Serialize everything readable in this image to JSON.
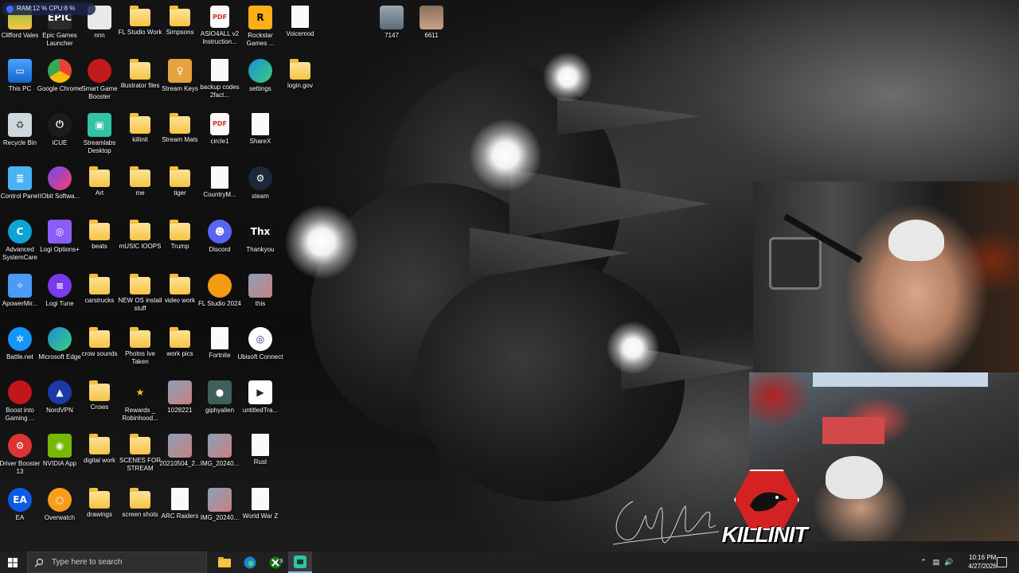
{
  "perf_overlay": {
    "text": "RAM:12 %  CPU:8 %"
  },
  "desktop": {
    "col1": [
      {
        "label": "Clifford Vales",
        "icon": "user-folder-icon"
      },
      {
        "label": "This PC",
        "icon": "pc-icon"
      },
      {
        "label": "Recycle Bin",
        "icon": "recycle-bin-icon"
      },
      {
        "label": "Control Panel",
        "icon": "control-panel-icon"
      },
      {
        "label": "Advanced SystemCare",
        "icon": "advanced-systemcare-icon"
      },
      {
        "label": "ApowerMir...",
        "icon": "apowermirror-icon"
      },
      {
        "label": "Battle.net",
        "icon": "battlenet-icon"
      },
      {
        "label": "Boost into Gaming ...",
        "icon": "boost-icon"
      },
      {
        "label": "Driver Booster 13",
        "icon": "driver-booster-icon"
      },
      {
        "label": "EA",
        "icon": "ea-icon"
      }
    ],
    "col2": [
      {
        "label": "Epic Games Launcher",
        "icon": "epic-games-icon"
      },
      {
        "label": "Google Chrome",
        "icon": "chrome-icon"
      },
      {
        "label": "iCUE",
        "icon": "icue-icon"
      },
      {
        "label": "IObit Softwa...",
        "icon": "iobit-icon"
      },
      {
        "label": "Logi Options+",
        "icon": "logi-options-icon"
      },
      {
        "label": "Logi Tune",
        "icon": "logi-tune-icon"
      },
      {
        "label": "Microsoft Edge",
        "icon": "edge-icon"
      },
      {
        "label": "NordVPN",
        "icon": "nordvpn-icon"
      },
      {
        "label": "NVIDIA App",
        "icon": "nvidia-icon"
      },
      {
        "label": "Overwatch",
        "icon": "overwatch-icon"
      }
    ],
    "col3": [
      {
        "label": "nnn",
        "icon": "app-icon"
      },
      {
        "label": "Smart Game Booster",
        "icon": "smart-game-booster-icon"
      },
      {
        "label": "Streamlabs Desktop",
        "icon": "streamlabs-icon"
      },
      {
        "label": "Art",
        "icon": "folder-icon"
      },
      {
        "label": "beats",
        "icon": "folder-icon"
      },
      {
        "label": "carstrucks",
        "icon": "folder-icon"
      },
      {
        "label": "crow sounds",
        "icon": "folder-icon"
      },
      {
        "label": "Crows",
        "icon": "folder-icon"
      },
      {
        "label": "digital work",
        "icon": "folder-icon"
      },
      {
        "label": "drawings",
        "icon": "folder-icon"
      }
    ],
    "col4": [
      {
        "label": "FL Studio Work",
        "icon": "folder-icon"
      },
      {
        "label": "illustrator files",
        "icon": "folder-icon"
      },
      {
        "label": "killinit",
        "icon": "folder-icon"
      },
      {
        "label": "me",
        "icon": "folder-icon"
      },
      {
        "label": "mUSIC lOOPS",
        "icon": "folder-icon"
      },
      {
        "label": "NEW OS install stuff",
        "icon": "folder-icon"
      },
      {
        "label": "Photos Ive Taken",
        "icon": "folder-icon"
      },
      {
        "label": "Rewards _ Robinhood...",
        "icon": "star-icon"
      },
      {
        "label": "SCENES FOR STREAM",
        "icon": "folder-icon"
      },
      {
        "label": "screen shots",
        "icon": "folder-icon"
      }
    ],
    "col5": [
      {
        "label": "Simpsons",
        "icon": "folder-icon"
      },
      {
        "label": "Stream Keys",
        "icon": "keys-icon"
      },
      {
        "label": "Stream Mats",
        "icon": "folder-icon"
      },
      {
        "label": "tiger",
        "icon": "folder-icon"
      },
      {
        "label": "Trump",
        "icon": "folder-icon"
      },
      {
        "label": "video work",
        "icon": "folder-icon"
      },
      {
        "label": "work pics",
        "icon": "folder-icon"
      },
      {
        "label": "1028221",
        "icon": "image-icon"
      },
      {
        "label": "20210504_2...",
        "icon": "image-icon"
      },
      {
        "label": "ARC Raiders",
        "icon": "file-icon"
      }
    ],
    "col6": [
      {
        "label": "ASIO4ALL v2 Instruction...",
        "icon": "pdf-icon"
      },
      {
        "label": "backup codes 2fact...",
        "icon": "file-icon"
      },
      {
        "label": "circle1",
        "icon": "pdf-icon"
      },
      {
        "label": "CountryM...",
        "icon": "file-icon"
      },
      {
        "label": "Discord",
        "icon": "discord-icon"
      },
      {
        "label": "FL Studio 2024",
        "icon": "fl-studio-icon"
      },
      {
        "label": "Fortnite",
        "icon": "file-icon"
      },
      {
        "label": "giphyalien",
        "icon": "alien-icon"
      },
      {
        "label": "IMG_20240...",
        "icon": "image-icon"
      },
      {
        "label": "IMG_20240...",
        "icon": "image-icon"
      }
    ],
    "col7": [
      {
        "label": "Rockstar Games ...",
        "icon": "rockstar-icon"
      },
      {
        "label": "settings",
        "icon": "edge-icon"
      },
      {
        "label": "ShareX",
        "icon": "file-icon"
      },
      {
        "label": "steam",
        "icon": "steam-icon"
      },
      {
        "label": "Thankyou",
        "icon": "thankyou-image-icon"
      },
      {
        "label": "this",
        "icon": "image-icon"
      },
      {
        "label": "Ubisoft Connect",
        "icon": "ubisoft-icon"
      },
      {
        "label": "untitledTra...",
        "icon": "video-icon"
      },
      {
        "label": "Rust",
        "icon": "file-icon"
      },
      {
        "label": "World War Z",
        "icon": "file-icon"
      }
    ],
    "col8": [
      {
        "label": "Voicemod",
        "icon": "file-icon"
      },
      {
        "label": "login.gov",
        "icon": "folder-icon"
      }
    ],
    "extra": [
      {
        "label": "7147",
        "icon": "image-icon"
      },
      {
        "label": "6611",
        "icon": "image-icon"
      }
    ]
  },
  "logo": {
    "text": "KILLINIT"
  },
  "taskbar": {
    "search_placeholder": "Type here to search",
    "xbox_badge": "3",
    "time": "10:16 PM",
    "date": "4/27/2026"
  },
  "colors": {
    "taskbar": "#202020",
    "logo_red": "#d42222",
    "folder": "#f6c443"
  }
}
